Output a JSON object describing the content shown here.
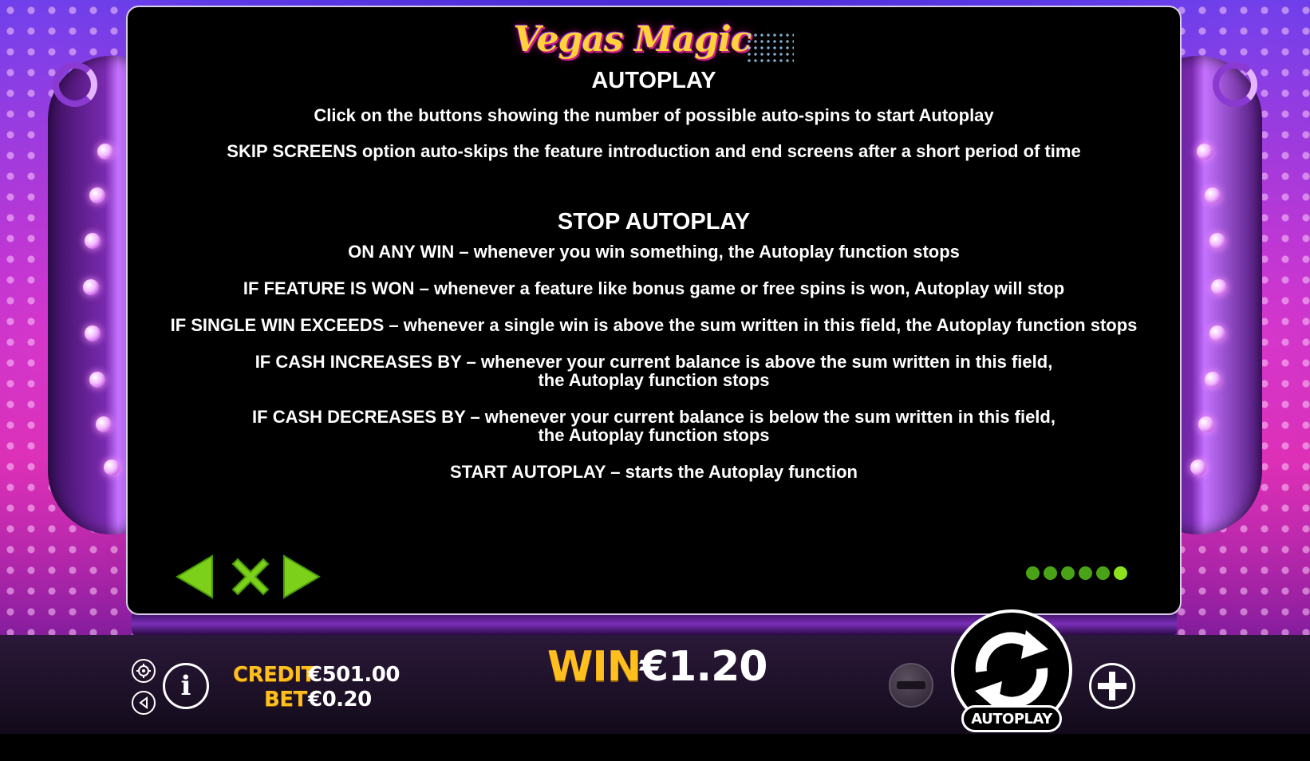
{
  "game": {
    "logo_text": "Vegas Magic"
  },
  "colors": {
    "accent_green": "#8ce01e",
    "gold": "#ffbf1e",
    "panel_bg": "#000000"
  },
  "help_page": {
    "heading_autoplay": "AUTOPLAY",
    "line_click": "Click on the buttons showing the number of possible auto-spins to start Autoplay",
    "line_skip": "SKIP SCREENS option auto-skips the feature introduction and end screens after a short period of time",
    "heading_stop": "STOP AUTOPLAY",
    "line_any_win": "ON ANY WIN – whenever you win something, the Autoplay function stops",
    "line_feature": "IF FEATURE IS WON – whenever a feature like bonus game or free spins is won, Autoplay will stop",
    "line_single_win": "IF SINGLE WIN EXCEEDS – whenever a single win is above the sum written in this field, the Autoplay function stops",
    "line_cash_inc": "IF CASH INCREASES BY – whenever your current balance is above the sum written in this field,\nthe Autoplay function stops",
    "line_cash_dec": "IF CASH DECREASES BY – whenever your current balance is below the sum written in this field,\nthe Autoplay function stops",
    "line_start": "START AUTOPLAY – starts the Autoplay function"
  },
  "navigation": {
    "prev_icon": "arrow-left-icon",
    "close_icon": "close-x-icon",
    "next_icon": "arrow-right-icon",
    "page_count": 6,
    "current_page": 6
  },
  "bottom_bar": {
    "credit_label": "CREDIT",
    "credit_value": "€501.00",
    "bet_label": "BET",
    "bet_value": "€0.20",
    "win_label": "WIN",
    "win_value": "€1.20",
    "autoplay_label": "AUTOPLAY",
    "settings_icon": "gear-icon",
    "sound_icon": "speaker-icon",
    "info_icon": "info-icon",
    "minus_icon": "minus-icon",
    "plus_icon": "plus-icon",
    "spin_icon": "spin-arrows-icon"
  }
}
